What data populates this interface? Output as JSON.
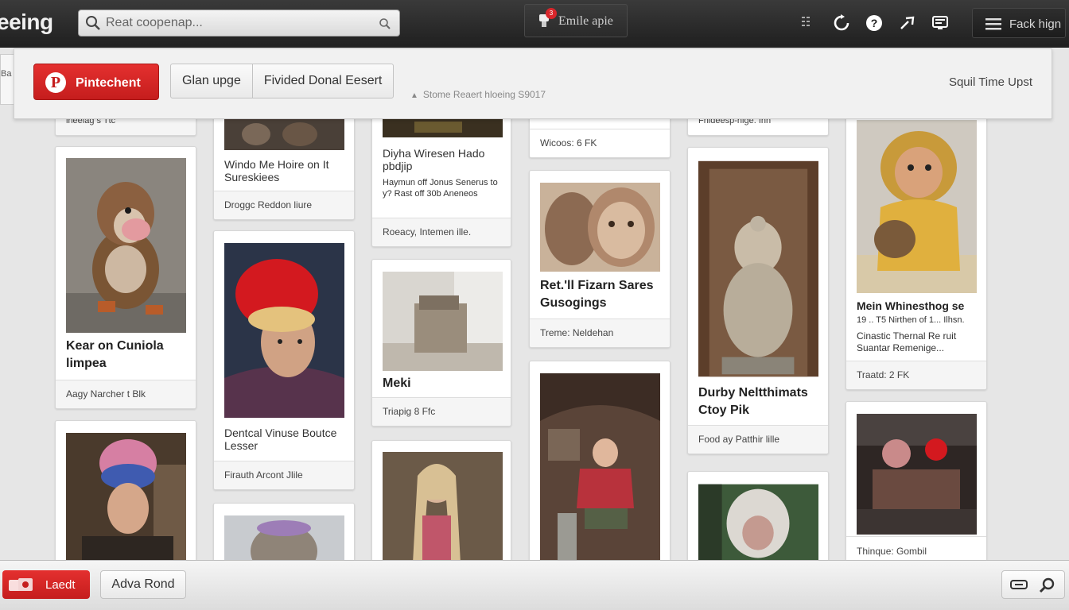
{
  "header": {
    "logo": "eeing",
    "search": {
      "placeholder": "Reat coopenap..."
    },
    "center_button": {
      "label": "Emile apie",
      "badge": "3"
    },
    "right_button": {
      "label": "Fack hign"
    }
  },
  "panel": {
    "left_stub": "Ba",
    "pin_button": "Pintechent",
    "segments": [
      "Glan upge",
      "Fivided Donal Eesert"
    ],
    "note": "Stome Reaert hloeing S9017",
    "right_link": "Squil Time Upst"
  },
  "pins": [
    {
      "title": "",
      "desc": "",
      "footer": "lneeiag s Ttc"
    },
    {
      "title": "Kear on Cuniola limpea",
      "desc": "",
      "footer": "Aagy Narcher t Blk"
    },
    {
      "title": "",
      "desc": "",
      "footer": ""
    },
    {
      "title": "",
      "desc": "Windo Me Hoire on It Sureskiees",
      "footer": "Droggc Reddon liure"
    },
    {
      "title": "",
      "desc": "Dentcal Vinuse Boutce Lesser",
      "footer": "Firauth Arcont Jlile"
    },
    {
      "title": "",
      "desc": "",
      "footer": ""
    },
    {
      "title": "",
      "desc": "Diyha Wiresen Hado pbdjip",
      "desc2": "Haymun off Jonus Senerus to y? Rast off 30b Aneneos",
      "footer": "Roeacy, Intemen ille."
    },
    {
      "title": "Meki",
      "desc": "",
      "footer": "Triapig 8 Ffc"
    },
    {
      "title": "",
      "desc": "",
      "footer": ""
    },
    {
      "title": "",
      "desc": "",
      "footer": "Wicoos: 6 FK"
    },
    {
      "title": "Ret.'ll Fizarn Sares Gusogings",
      "desc": "",
      "footer": "Treme: Neldehan"
    },
    {
      "title": "",
      "desc": "",
      "footer": ""
    },
    {
      "title": "",
      "desc": "",
      "footer": "Fhideesp-hige. Ihn"
    },
    {
      "title": "Durby Neltthimats Ctoy Pik",
      "desc": "",
      "footer": "Food ay Patthir lille"
    },
    {
      "title": "",
      "desc": "",
      "footer": ""
    },
    {
      "title": "Mein Whinesthog se",
      "desc": "19 .. T5 Nirthen of 1... Ilhsn.",
      "desc2": "Cinastic Thernal Re ruit Suantar Remenige...",
      "footer": "Traatd: 2 FK"
    },
    {
      "title": "",
      "desc": "",
      "footer": "Thinque: Gombil"
    }
  ],
  "bottombar": {
    "red_button": "Laedt",
    "adv_button": "Adva Rond"
  },
  "colors": {
    "accent": "#c51d1d",
    "topbar": "#2a2a2a"
  }
}
